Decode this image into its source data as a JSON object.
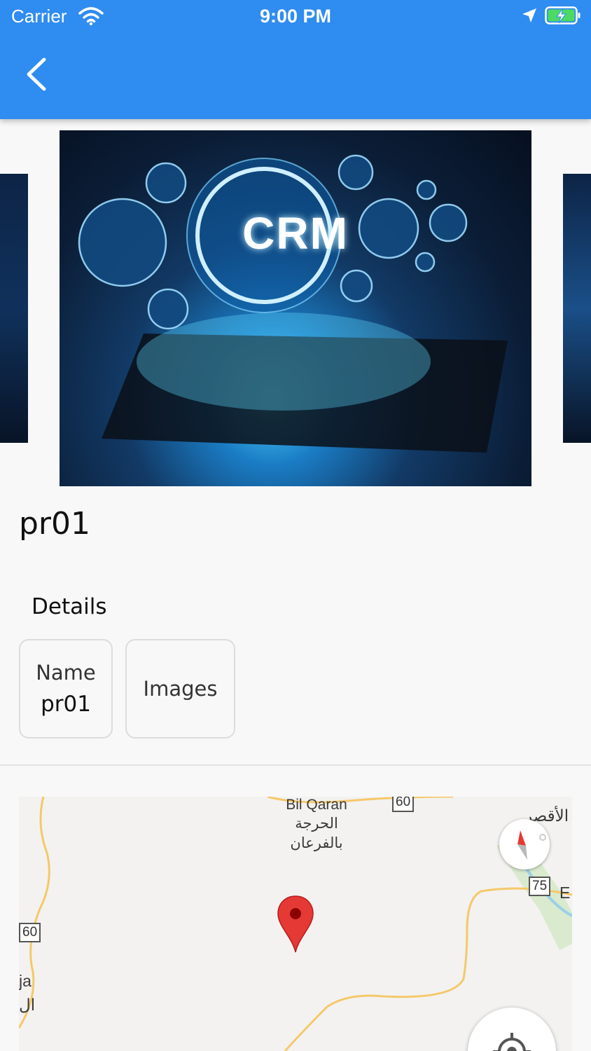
{
  "status_bar": {
    "carrier": "Carrier",
    "time": "9:00 PM",
    "wifi_icon": "wifi-icon",
    "location_icon": "location-arrow-icon",
    "battery_icon": "battery-charging-icon"
  },
  "app_bar": {
    "color": "#2f8cf0",
    "back_icon": "chevron-left-icon"
  },
  "carousel": {
    "image_text": "CRM"
  },
  "product": {
    "title": "pr01"
  },
  "details": {
    "heading": "Details",
    "cards": [
      {
        "label": "Name",
        "value": "pr01"
      },
      {
        "label": "Images",
        "value": ""
      }
    ]
  },
  "map": {
    "labels": {
      "town_latin": "Bil Qaran",
      "town_arabic_1": "الحرجة",
      "town_arabic_2": "بالفرعان",
      "top_right_arabic": "الأقصر",
      "edge_right": "E",
      "edge_left_latin": "ja",
      "edge_left_arabic": "ال"
    },
    "road_shields": [
      "60",
      "60",
      "75"
    ],
    "marker_color": "#e53935"
  }
}
